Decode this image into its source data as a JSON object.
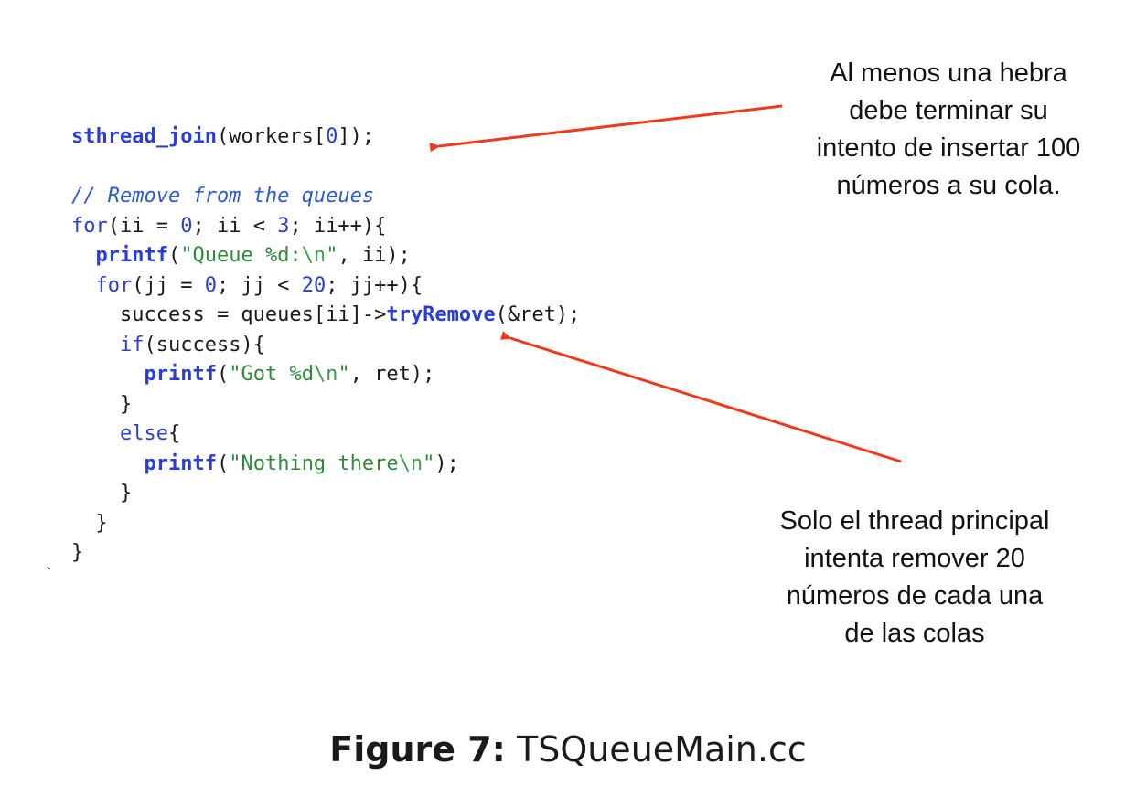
{
  "code": {
    "lines": [
      [
        {
          "t": "sthread_join",
          "c": "fn"
        },
        {
          "t": "(workers[",
          "c": "txt"
        },
        {
          "t": "0",
          "c": "num"
        },
        {
          "t": "]);",
          "c": "txt"
        }
      ],
      [],
      [
        {
          "t": "// Remove from the queues",
          "c": "cm"
        }
      ],
      [
        {
          "t": "for",
          "c": "kw"
        },
        {
          "t": "(ii = ",
          "c": "txt"
        },
        {
          "t": "0",
          "c": "num"
        },
        {
          "t": "; ii < ",
          "c": "txt"
        },
        {
          "t": "3",
          "c": "num"
        },
        {
          "t": "; ii++){",
          "c": "txt"
        }
      ],
      [
        {
          "t": "  ",
          "c": "txt"
        },
        {
          "t": "printf",
          "c": "fn"
        },
        {
          "t": "(",
          "c": "txt"
        },
        {
          "t": "\"Queue %d:",
          "c": "str"
        },
        {
          "t": "\\n",
          "c": "esc"
        },
        {
          "t": "\"",
          "c": "str"
        },
        {
          "t": ", ii);",
          "c": "txt"
        }
      ],
      [
        {
          "t": "  ",
          "c": "txt"
        },
        {
          "t": "for",
          "c": "kw"
        },
        {
          "t": "(jj = ",
          "c": "txt"
        },
        {
          "t": "0",
          "c": "num"
        },
        {
          "t": "; jj < ",
          "c": "txt"
        },
        {
          "t": "20",
          "c": "num"
        },
        {
          "t": "; jj++){",
          "c": "txt"
        }
      ],
      [
        {
          "t": "    success = queues[ii]->",
          "c": "txt"
        },
        {
          "t": "tryRemove",
          "c": "fn"
        },
        {
          "t": "(&ret);",
          "c": "txt"
        }
      ],
      [
        {
          "t": "    ",
          "c": "txt"
        },
        {
          "t": "if",
          "c": "kw"
        },
        {
          "t": "(success){",
          "c": "txt"
        }
      ],
      [
        {
          "t": "      ",
          "c": "txt"
        },
        {
          "t": "printf",
          "c": "fn"
        },
        {
          "t": "(",
          "c": "txt"
        },
        {
          "t": "\"Got %d",
          "c": "str"
        },
        {
          "t": "\\n",
          "c": "esc"
        },
        {
          "t": "\"",
          "c": "str"
        },
        {
          "t": ", ret);",
          "c": "txt"
        }
      ],
      [
        {
          "t": "    }",
          "c": "txt"
        }
      ],
      [
        {
          "t": "    ",
          "c": "txt"
        },
        {
          "t": "else",
          "c": "kw"
        },
        {
          "t": "{",
          "c": "txt"
        }
      ],
      [
        {
          "t": "      ",
          "c": "txt"
        },
        {
          "t": "printf",
          "c": "fn"
        },
        {
          "t": "(",
          "c": "txt"
        },
        {
          "t": "\"Nothing there",
          "c": "str"
        },
        {
          "t": "\\n",
          "c": "esc"
        },
        {
          "t": "\"",
          "c": "str"
        },
        {
          "t": ");",
          "c": "txt"
        }
      ],
      [
        {
          "t": "    }",
          "c": "txt"
        }
      ],
      [
        {
          "t": "  }",
          "c": "txt"
        }
      ],
      [
        {
          "t": "}",
          "c": "txt"
        }
      ]
    ]
  },
  "annotations": {
    "top": {
      "lines": [
        "Al menos una hebra",
        "debe terminar su",
        "intento de insertar 100",
        "números a su cola."
      ]
    },
    "bottom": {
      "lines": [
        "Solo el thread principal",
        "intenta remover 20",
        "números de cada una",
        "de las colas"
      ]
    }
  },
  "colors": {
    "arrow": "#ee3b1f",
    "function": "#2a3ed6",
    "string": "#2e8b3a",
    "comment": "#2a5bd6"
  },
  "stray_mark": "`",
  "caption": {
    "label": "Figure 7:",
    "text": "TSQueueMain.cc"
  }
}
